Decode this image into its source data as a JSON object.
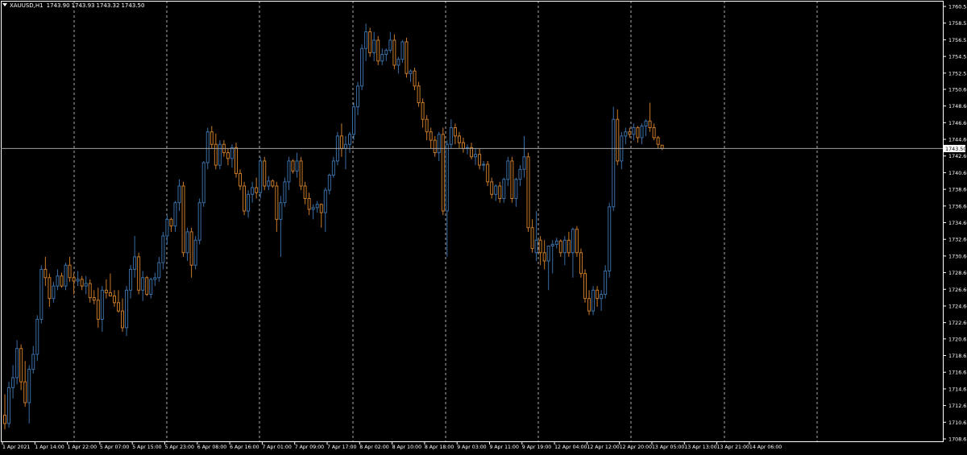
{
  "window": {
    "symbol": "XAUUSD,H1",
    "ohlc": [
      "1743.90",
      "1743.93",
      "1743.32",
      "1743.50"
    ]
  },
  "colors": {
    "background": "#000000",
    "axis": "#ffffff",
    "grid": "#c8c8c8",
    "bull": "#3a6ea5",
    "bear": "#c87a28",
    "price_line": "#a0a0a0",
    "price_label_bg": "#ffffff",
    "price_label_text": "#000000"
  },
  "chart_data": {
    "type": "candlestick",
    "symbol": "XAUUSD",
    "timeframe": "H1",
    "y_ticks": [
      "1760.55",
      "1758.55",
      "1756.55",
      "1754.55",
      "1752.55",
      "1750.60",
      "1748.60",
      "1746.60",
      "1744.60",
      "1742.60",
      "1740.60",
      "1738.60",
      "1736.60",
      "1734.60",
      "1732.60",
      "1730.60",
      "1728.60",
      "1726.60",
      "1724.60",
      "1722.60",
      "1720.65",
      "1718.65",
      "1716.65",
      "1714.65",
      "1712.65",
      "1710.65",
      "1708.65"
    ],
    "ylim": [
      1708.65,
      1760.55
    ],
    "x_ticks": [
      "1 Apr 2021",
      "1 Apr 14:00",
      "1 Apr 22:00",
      "5 Apr 07:00",
      "5 Apr 15:00",
      "5 Apr 23:00",
      "6 Apr 08:00",
      "6 Apr 16:00",
      "7 Apr 01:00",
      "7 Apr 09:00",
      "7 Apr 17:00",
      "8 Apr 02:00",
      "8 Apr 10:00",
      "8 Apr 18:00",
      "9 Apr 03:00",
      "9 Apr 11:00",
      "9 Apr 19:00",
      "12 Apr 04:00",
      "12 Apr 12:00",
      "12 Apr 20:00",
      "13 Apr 05:00",
      "13 Apr 13:00",
      "13 Apr 21:00",
      "14 Apr 06:00"
    ],
    "current_price": "1743.50",
    "grid": "vertical-dashed-per-day",
    "candles": [
      [
        1711.5,
        1714.0,
        1709.8,
        1710.5
      ],
      [
        1710.5,
        1715.5,
        1710.0,
        1714.8
      ],
      [
        1714.8,
        1717.5,
        1713.5,
        1716.0
      ],
      [
        1716.0,
        1720.5,
        1715.2,
        1719.5
      ],
      [
        1719.5,
        1720.0,
        1714.5,
        1715.5
      ],
      [
        1715.5,
        1718.0,
        1712.5,
        1713.0
      ],
      [
        1713.0,
        1717.5,
        1710.5,
        1717.0
      ],
      [
        1717.0,
        1719.8,
        1716.5,
        1718.8
      ],
      [
        1718.8,
        1723.5,
        1718.0,
        1723.0
      ],
      [
        1723.0,
        1729.5,
        1722.5,
        1729.0
      ],
      [
        1729.0,
        1730.5,
        1727.0,
        1728.0
      ],
      [
        1728.0,
        1728.5,
        1724.5,
        1725.5
      ],
      [
        1725.5,
        1727.5,
        1725.0,
        1727.0
      ],
      [
        1727.0,
        1729.0,
        1726.5,
        1728.2
      ],
      [
        1728.2,
        1728.6,
        1726.8,
        1727.0
      ],
      [
        1727.0,
        1729.8,
        1726.5,
        1729.5
      ],
      [
        1729.5,
        1730.5,
        1727.5,
        1728.0
      ],
      [
        1728.0,
        1728.5,
        1726.0,
        1727.6
      ],
      [
        1727.6,
        1728.8,
        1727.0,
        1727.8
      ],
      [
        1727.8,
        1728.2,
        1726.5,
        1727.0
      ],
      [
        1727.0,
        1728.2,
        1726.0,
        1727.3
      ],
      [
        1727.3,
        1727.8,
        1725.0,
        1725.6
      ],
      [
        1725.6,
        1726.5,
        1724.8,
        1725.3
      ],
      [
        1725.3,
        1726.8,
        1722.0,
        1723.0
      ],
      [
        1723.0,
        1727.0,
        1721.5,
        1726.5
      ],
      [
        1726.5,
        1727.8,
        1725.5,
        1726.2
      ],
      [
        1726.2,
        1728.5,
        1725.8,
        1725.8
      ],
      [
        1725.8,
        1726.5,
        1724.5,
        1725.0
      ],
      [
        1725.0,
        1726.5,
        1723.8,
        1724.0
      ],
      [
        1724.0,
        1725.5,
        1721.5,
        1722.0
      ],
      [
        1722.0,
        1727.0,
        1721.0,
        1726.5
      ],
      [
        1726.5,
        1729.5,
        1725.5,
        1729.0
      ],
      [
        1729.0,
        1733.0,
        1728.0,
        1730.5
      ],
      [
        1730.5,
        1731.0,
        1726.0,
        1726.5
      ],
      [
        1726.5,
        1728.8,
        1725.2,
        1728.0
      ],
      [
        1728.0,
        1728.2,
        1725.8,
        1726.0
      ],
      [
        1726.0,
        1728.0,
        1725.5,
        1727.8
      ],
      [
        1727.8,
        1728.6,
        1727.0,
        1728.0
      ],
      [
        1728.0,
        1730.5,
        1727.5,
        1729.8
      ],
      [
        1729.8,
        1733.5,
        1729.0,
        1733.0
      ],
      [
        1733.0,
        1735.5,
        1732.0,
        1735.0
      ],
      [
        1735.0,
        1735.2,
        1733.5,
        1734.2
      ],
      [
        1734.2,
        1737.2,
        1733.5,
        1737.0
      ],
      [
        1737.0,
        1739.8,
        1736.0,
        1739.0
      ],
      [
        1739.0,
        1739.5,
        1730.5,
        1731.0
      ],
      [
        1731.0,
        1734.0,
        1730.0,
        1733.5
      ],
      [
        1733.5,
        1734.0,
        1728.0,
        1729.5
      ],
      [
        1729.5,
        1733.0,
        1729.0,
        1732.5
      ],
      [
        1732.5,
        1737.5,
        1732.0,
        1737.0
      ],
      [
        1737.0,
        1742.0,
        1736.5,
        1741.8
      ],
      [
        1741.8,
        1746.0,
        1741.0,
        1745.5
      ],
      [
        1745.5,
        1746.2,
        1743.5,
        1744.0
      ],
      [
        1744.0,
        1745.3,
        1741.0,
        1741.5
      ],
      [
        1741.5,
        1744.5,
        1741.0,
        1744.0
      ],
      [
        1744.0,
        1744.5,
        1742.5,
        1743.0
      ],
      [
        1743.0,
        1743.5,
        1741.5,
        1742.3
      ],
      [
        1742.3,
        1744.0,
        1741.2,
        1743.6
      ],
      [
        1743.6,
        1744.2,
        1740.0,
        1740.5
      ],
      [
        1740.5,
        1741.0,
        1738.5,
        1739.0
      ],
      [
        1739.0,
        1739.5,
        1735.5,
        1736.0
      ],
      [
        1736.0,
        1738.5,
        1735.2,
        1738.0
      ],
      [
        1738.0,
        1739.5,
        1737.0,
        1738.8
      ],
      [
        1738.8,
        1740.0,
        1737.5,
        1738.2
      ],
      [
        1738.2,
        1742.5,
        1737.5,
        1742.0
      ],
      [
        1742.0,
        1742.5,
        1738.5,
        1739.0
      ],
      [
        1739.0,
        1740.2,
        1738.5,
        1739.6
      ],
      [
        1739.6,
        1739.8,
        1738.8,
        1739.0
      ],
      [
        1739.0,
        1739.5,
        1733.5,
        1735.0
      ],
      [
        1735.0,
        1737.8,
        1730.5,
        1737.0
      ],
      [
        1737.0,
        1740.0,
        1736.5,
        1739.5
      ],
      [
        1739.5,
        1742.5,
        1738.5,
        1742.0
      ],
      [
        1742.0,
        1742.2,
        1740.5,
        1740.8
      ],
      [
        1740.8,
        1743.0,
        1740.0,
        1742.0
      ],
      [
        1742.0,
        1742.5,
        1738.5,
        1739.0
      ],
      [
        1739.0,
        1739.5,
        1736.8,
        1737.5
      ],
      [
        1737.5,
        1738.2,
        1735.5,
        1736.2
      ],
      [
        1736.2,
        1736.8,
        1735.0,
        1736.4
      ],
      [
        1736.4,
        1737.2,
        1735.8,
        1736.8
      ],
      [
        1736.8,
        1736.9,
        1734.0,
        1735.8
      ],
      [
        1735.8,
        1738.8,
        1733.5,
        1738.5
      ],
      [
        1738.5,
        1740.5,
        1738.0,
        1740.3
      ],
      [
        1740.3,
        1742.5,
        1740.0,
        1742.0
      ],
      [
        1742.0,
        1745.5,
        1741.5,
        1745.0
      ],
      [
        1745.0,
        1746.5,
        1742.5,
        1743.5
      ],
      [
        1743.5,
        1745.0,
        1741.0,
        1744.0
      ],
      [
        1744.0,
        1745.5,
        1743.0,
        1745.2
      ],
      [
        1745.2,
        1749.0,
        1744.5,
        1748.5
      ],
      [
        1748.5,
        1751.5,
        1747.5,
        1751.0
      ],
      [
        1751.0,
        1756.0,
        1750.5,
        1755.5
      ],
      [
        1755.5,
        1758.5,
        1754.0,
        1757.5
      ],
      [
        1757.5,
        1758.0,
        1754.5,
        1755.0
      ],
      [
        1755.0,
        1757.5,
        1754.0,
        1756.5
      ],
      [
        1756.5,
        1757.0,
        1753.5,
        1754.0
      ],
      [
        1754.0,
        1755.5,
        1753.5,
        1754.8
      ],
      [
        1754.8,
        1755.5,
        1754.0,
        1755.3
      ],
      [
        1755.3,
        1757.5,
        1755.0,
        1756.5
      ],
      [
        1756.5,
        1757.2,
        1753.0,
        1753.5
      ],
      [
        1753.5,
        1754.5,
        1752.5,
        1754.2
      ],
      [
        1754.2,
        1756.5,
        1753.8,
        1756.3
      ],
      [
        1756.3,
        1756.8,
        1752.0,
        1752.5
      ],
      [
        1752.5,
        1753.0,
        1751.5,
        1752.8
      ],
      [
        1752.8,
        1753.2,
        1750.5,
        1751.0
      ],
      [
        1751.0,
        1751.5,
        1748.5,
        1749.0
      ],
      [
        1749.0,
        1749.5,
        1746.0,
        1747.0
      ],
      [
        1747.0,
        1747.5,
        1744.5,
        1745.5
      ],
      [
        1745.5,
        1746.0,
        1743.5,
        1744.5
      ],
      [
        1744.5,
        1745.0,
        1742.5,
        1743.0
      ],
      [
        1743.0,
        1745.5,
        1742.0,
        1745.2
      ],
      [
        1745.2,
        1746.0,
        1735.5,
        1736.0
      ],
      [
        1736.0,
        1744.5,
        1730.5,
        1744.0
      ],
      [
        1744.0,
        1747.0,
        1743.5,
        1746.0
      ],
      [
        1746.0,
        1746.5,
        1744.0,
        1745.0
      ],
      [
        1745.0,
        1745.5,
        1743.5,
        1744.2
      ],
      [
        1744.2,
        1744.8,
        1743.0,
        1743.5
      ],
      [
        1743.5,
        1744.0,
        1742.8,
        1743.6
      ],
      [
        1743.6,
        1744.2,
        1742.2,
        1742.5
      ],
      [
        1742.5,
        1743.5,
        1741.5,
        1742.8
      ],
      [
        1742.8,
        1743.5,
        1741.0,
        1741.5
      ],
      [
        1741.5,
        1742.0,
        1740.8,
        1741.6
      ],
      [
        1741.6,
        1742.0,
        1739.0,
        1739.5
      ],
      [
        1739.5,
        1740.0,
        1737.5,
        1738.0
      ],
      [
        1738.0,
        1739.2,
        1737.2,
        1739.0
      ],
      [
        1739.0,
        1739.5,
        1737.0,
        1737.5
      ],
      [
        1737.5,
        1740.0,
        1737.0,
        1739.8
      ],
      [
        1739.8,
        1742.5,
        1739.0,
        1742.0
      ],
      [
        1742.0,
        1742.5,
        1737.0,
        1737.5
      ],
      [
        1737.5,
        1740.0,
        1736.5,
        1739.8
      ],
      [
        1739.8,
        1741.5,
        1739.0,
        1741.0
      ],
      [
        1741.0,
        1745.0,
        1740.0,
        1742.5
      ],
      [
        1742.5,
        1743.0,
        1733.5,
        1734.0
      ],
      [
        1734.0,
        1735.0,
        1731.0,
        1731.5
      ],
      [
        1731.0,
        1736.0,
        1730.0,
        1732.5
      ],
      [
        1732.5,
        1733.0,
        1729.5,
        1731.0
      ],
      [
        1731.0,
        1732.5,
        1729.0,
        1730.0
      ],
      [
        1730.0,
        1730.5,
        1726.5,
        1731.8
      ],
      [
        1731.8,
        1732.5,
        1728.5,
        1732.0
      ],
      [
        1732.0,
        1732.8,
        1731.5,
        1732.4
      ],
      [
        1732.4,
        1732.6,
        1730.5,
        1731.0
      ],
      [
        1731.0,
        1733.0,
        1729.5,
        1732.5
      ],
      [
        1732.5,
        1733.5,
        1730.5,
        1731.0
      ],
      [
        1731.0,
        1734.0,
        1728.0,
        1733.8
      ],
      [
        1733.8,
        1734.2,
        1730.5,
        1731.0
      ],
      [
        1731.0,
        1731.5,
        1728.0,
        1728.5
      ],
      [
        1728.5,
        1729.0,
        1725.0,
        1725.5
      ],
      [
        1725.5,
        1726.5,
        1723.5,
        1724.0
      ],
      [
        1724.0,
        1727.0,
        1723.5,
        1726.5
      ],
      [
        1726.5,
        1727.0,
        1724.5,
        1725.5
      ],
      [
        1725.5,
        1726.5,
        1724.0,
        1726.0
      ],
      [
        1726.0,
        1729.5,
        1725.5,
        1728.8
      ],
      [
        1728.8,
        1737.0,
        1728.0,
        1736.5
      ],
      [
        1736.5,
        1748.5,
        1736.0,
        1747.0
      ],
      [
        1747.0,
        1748.2,
        1741.5,
        1742.0
      ],
      [
        1742.0,
        1745.5,
        1741.0,
        1745.0
      ],
      [
        1745.0,
        1746.0,
        1744.0,
        1745.5
      ],
      [
        1745.5,
        1746.0,
        1744.8,
        1745.2
      ],
      [
        1745.2,
        1746.5,
        1744.5,
        1746.0
      ],
      [
        1746.0,
        1746.2,
        1744.2,
        1744.8
      ],
      [
        1744.8,
        1746.5,
        1744.0,
        1746.2
      ],
      [
        1746.2,
        1747.0,
        1745.0,
        1746.8
      ],
      [
        1746.8,
        1749.0,
        1745.5,
        1746.0
      ],
      [
        1746.0,
        1746.5,
        1744.5,
        1744.8
      ],
      [
        1744.8,
        1745.0,
        1743.5,
        1744.0
      ],
      [
        1743.9,
        1743.93,
        1743.32,
        1743.5
      ]
    ]
  }
}
